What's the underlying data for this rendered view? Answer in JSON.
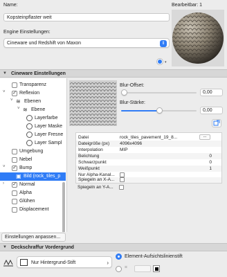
{
  "header": {
    "name_label": "Name:",
    "editor_label": "Bearbeitbar: 1",
    "name_value": "Kopsteinpflaster weit"
  },
  "engine": {
    "label": "Engine Einstellungen:",
    "selected": "Cineware und Redshift von Maxon"
  },
  "sections": {
    "cineware": "Cineware Einstellungen",
    "deck": "Deckschraffur Vordergrund"
  },
  "tree": {
    "items": [
      {
        "label": "Transparenz"
      },
      {
        "label": "Reflexion"
      },
      {
        "label": "Ebenen"
      },
      {
        "label": "Ebene"
      },
      {
        "label": "Layerfarbe"
      },
      {
        "label": "Layer Maske"
      },
      {
        "label": "Layer Fresne"
      },
      {
        "label": "Layer Sampl"
      },
      {
        "label": "Umgebung"
      },
      {
        "label": "Nebel"
      },
      {
        "label": "Bump"
      },
      {
        "label": "Bild (rock_tiles_p"
      },
      {
        "label": "Normal"
      },
      {
        "label": "Alpha"
      },
      {
        "label": "Glühen"
      },
      {
        "label": "Displacement"
      }
    ],
    "adjust_button": "Einstellungen anpassen..."
  },
  "texture": {
    "blur_offset_label": "Blur-Offset:",
    "blur_offset_value": "0,00",
    "blur_offset_level": 0.0,
    "blur_strength_label": "Blur-Stärke:",
    "blur_strength_value": "0,00",
    "blur_strength_level": 0.5
  },
  "table": {
    "rows": [
      {
        "key": "Datei",
        "value": "rock_tiles_pavement_19_8...",
        "dots": "..."
      },
      {
        "key": "Dateigröße (px)",
        "value": "4096x4096"
      },
      {
        "key": "Interpolation",
        "value": "MIP"
      },
      {
        "key": "Belichtung",
        "rvalue": "0"
      },
      {
        "key": "Schwarzpunkt",
        "rvalue": "0"
      },
      {
        "key": "Weißpunkt",
        "rvalue": "1"
      },
      {
        "key": "Nur Alpha-Kanal..."
      },
      {
        "key": "Spiegeln an X-A..."
      },
      {
        "key": "Spiegeln an Y-A..."
      }
    ]
  },
  "deck": {
    "pen_label": "Nur Hintergrund-Stift",
    "radio_label": "Element-Aufsichtslinienstift"
  },
  "colors": {
    "accent": "#2f7cf6"
  }
}
